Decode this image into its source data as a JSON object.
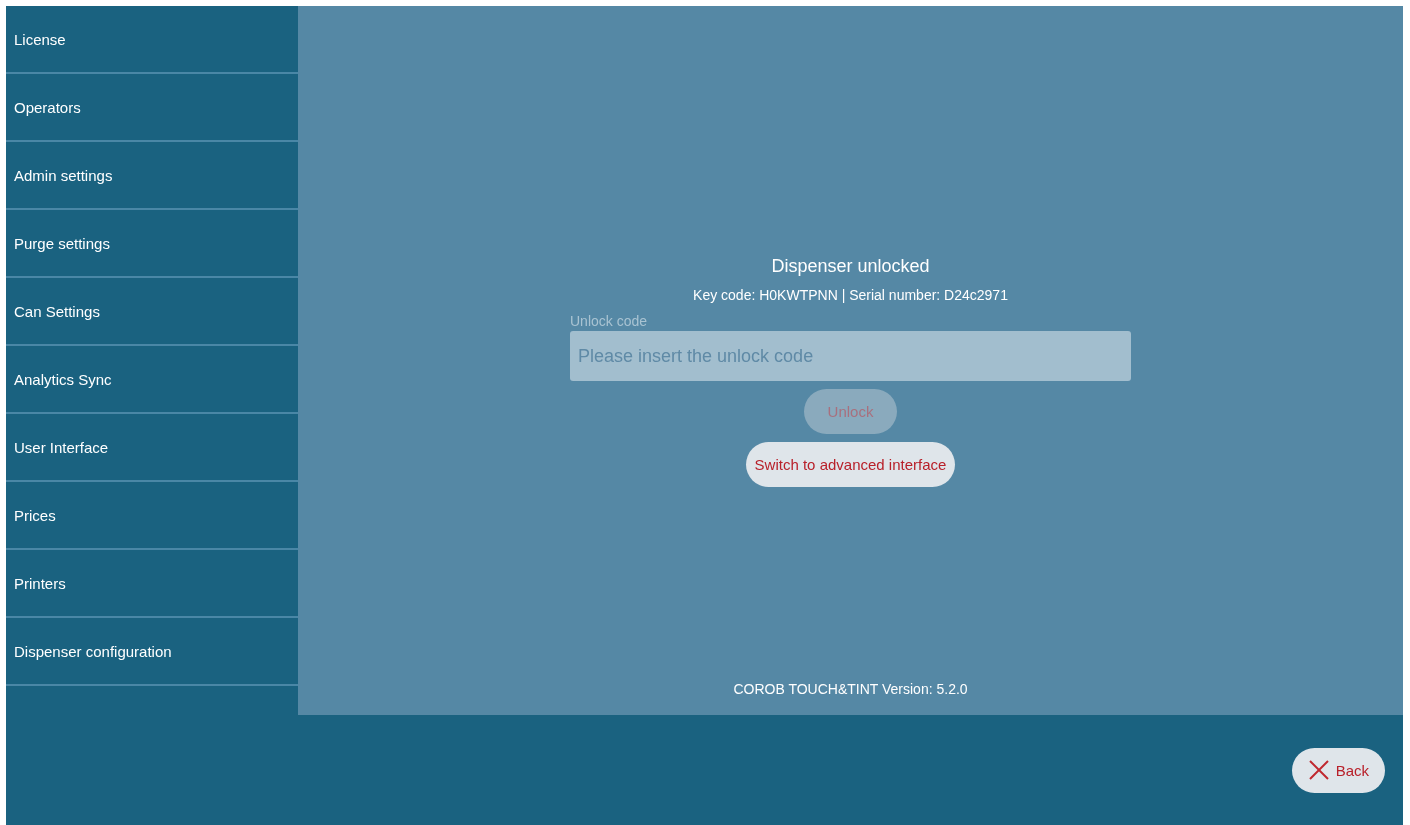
{
  "sidebar": {
    "items": [
      {
        "label": "License"
      },
      {
        "label": "Operators"
      },
      {
        "label": "Admin settings"
      },
      {
        "label": "Purge settings"
      },
      {
        "label": "Can Settings"
      },
      {
        "label": "Analytics Sync"
      },
      {
        "label": "User Interface"
      },
      {
        "label": "Prices"
      },
      {
        "label": "Printers"
      },
      {
        "label": "Dispenser configuration"
      }
    ]
  },
  "unlock_panel": {
    "title": "Dispenser unlocked",
    "info": "Key code: H0KWTPNN | Serial number: D24c2971",
    "field": {
      "label": "Unlock code",
      "placeholder": "Please insert the unlock code"
    },
    "unlock_button": {
      "label": "Unlock",
      "disabled": true
    },
    "switch_button": {
      "label": "Switch to advanced interface",
      "disabled": false
    }
  },
  "version": "COROB TOUCH&TINT Version: 5.2.0",
  "back_button": {
    "label": "Back"
  }
}
